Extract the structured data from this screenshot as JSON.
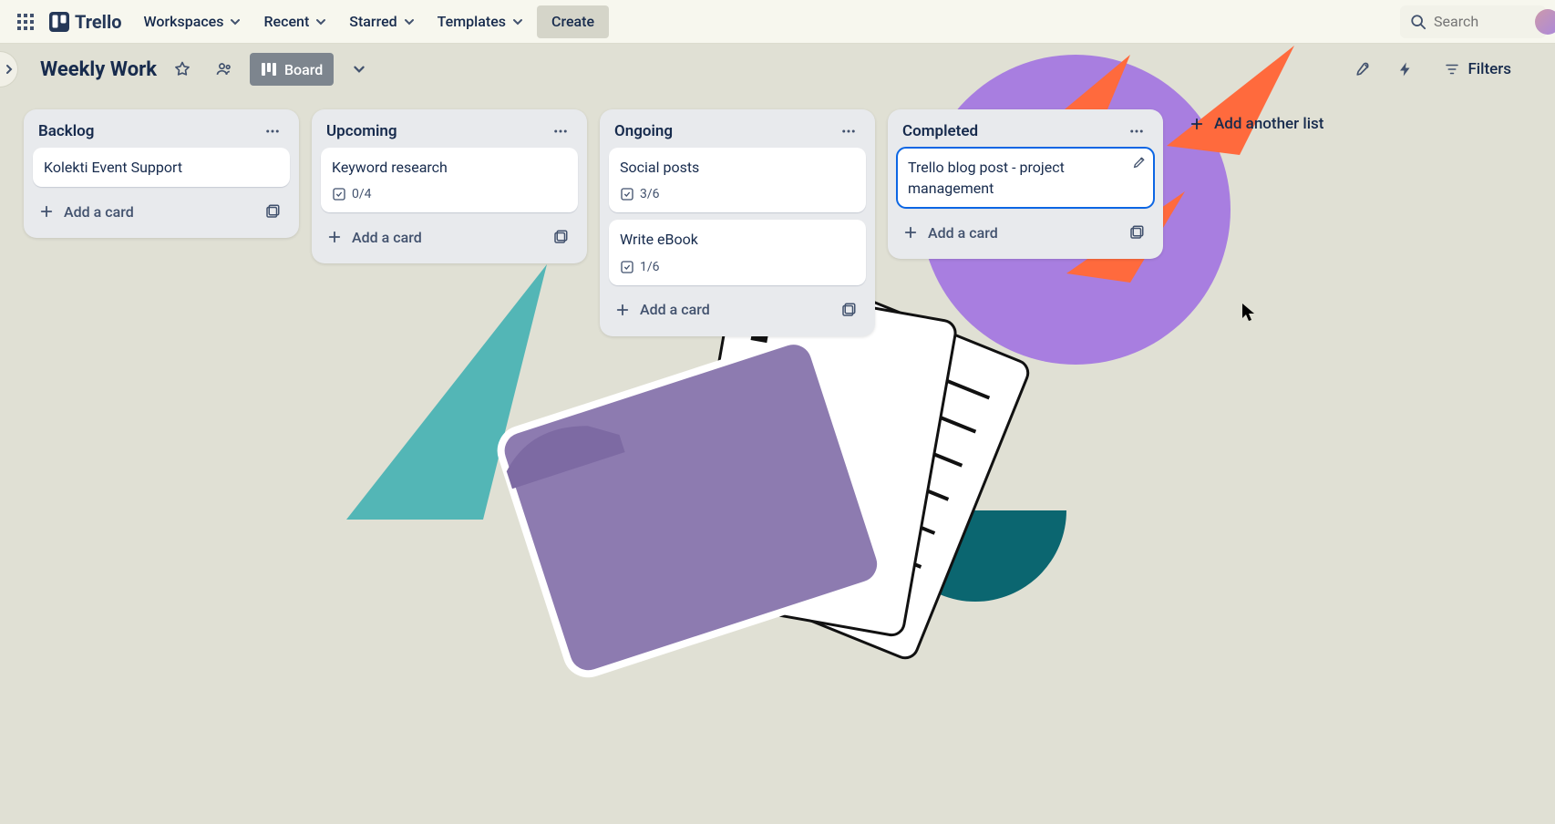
{
  "app_name": "Trello",
  "topnav": {
    "items": [
      "Workspaces",
      "Recent",
      "Starred",
      "Templates"
    ],
    "create_label": "Create",
    "search_placeholder": "Search"
  },
  "board_header": {
    "title": "Weekly Work",
    "view_label": "Board",
    "filters_label": "Filters"
  },
  "lists": [
    {
      "title": "Backlog",
      "cards": [
        {
          "title": "Kolekti Event Support"
        }
      ],
      "add_card_label": "Add a card"
    },
    {
      "title": "Upcoming",
      "cards": [
        {
          "title": "Keyword research",
          "checklist": "0/4"
        }
      ],
      "add_card_label": "Add a card"
    },
    {
      "title": "Ongoing",
      "cards": [
        {
          "title": "Social posts",
          "checklist": "3/6"
        },
        {
          "title": "Write eBook",
          "checklist": "1/6"
        }
      ],
      "add_card_label": "Add a card"
    },
    {
      "title": "Completed",
      "cards": [
        {
          "title": "Trello blog post - project management",
          "selected": true
        }
      ],
      "add_card_label": "Add a card"
    }
  ],
  "add_list_label": "Add another list",
  "icons": {
    "apps": "apps-icon",
    "chevron_down": "chevron-down-icon",
    "search": "search-icon",
    "star": "star-icon",
    "people": "people-icon",
    "board": "board-icon",
    "rocket": "rocket-icon",
    "bolt": "bolt-icon",
    "filter": "filter-icon",
    "ellipsis": "ellipsis-icon",
    "plus": "plus-icon",
    "template": "template-icon",
    "checklist": "checklist-icon",
    "pencil": "pencil-icon",
    "chevron_right": "chevron-right-icon"
  },
  "colors": {
    "bg": "#e0e0d4",
    "list_bg": "#e8eaed",
    "card_bg": "#ffffff",
    "text": "#172b4d",
    "muted": "#42526e",
    "accent": "#0c66e4",
    "purple": "#a87ee0",
    "teal": "#56b8b8",
    "dark_teal": "#0b6670",
    "orange": "#ff6a3d"
  }
}
